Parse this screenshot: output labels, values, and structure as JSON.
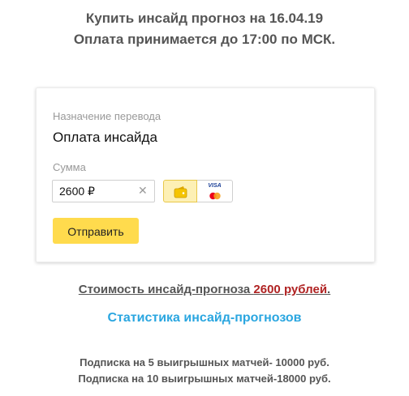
{
  "header": {
    "line1": "Купить инсайд прогноз на 16.04.19",
    "line2": "Оплата принимается до 17:00 по МСК."
  },
  "form": {
    "purpose_label": "Назначение перевода",
    "purpose_value": "Оплата инсайда",
    "sum_label": "Сумма",
    "amount_value": "2600 ₽",
    "clear_glyph": "✕",
    "payment_methods": [
      "yandex-wallet-icon",
      "visa-mastercard-icon"
    ],
    "card_brand": "VISA",
    "submit_label": "Отправить",
    "accent_color": "#ffdb4d"
  },
  "pricing": {
    "prefix": "Стоимость инсайд-прогноза ",
    "price": "2600 рублей",
    "suffix": ".",
    "price_color": "#b02323"
  },
  "stats_link": "Статистика инсайд-прогнозов",
  "subscriptions": [
    "Подписка на 5 выигрышных  матчей- 10000 руб.",
    "Подписка на 10 выигрышных матчей-18000 руб."
  ]
}
